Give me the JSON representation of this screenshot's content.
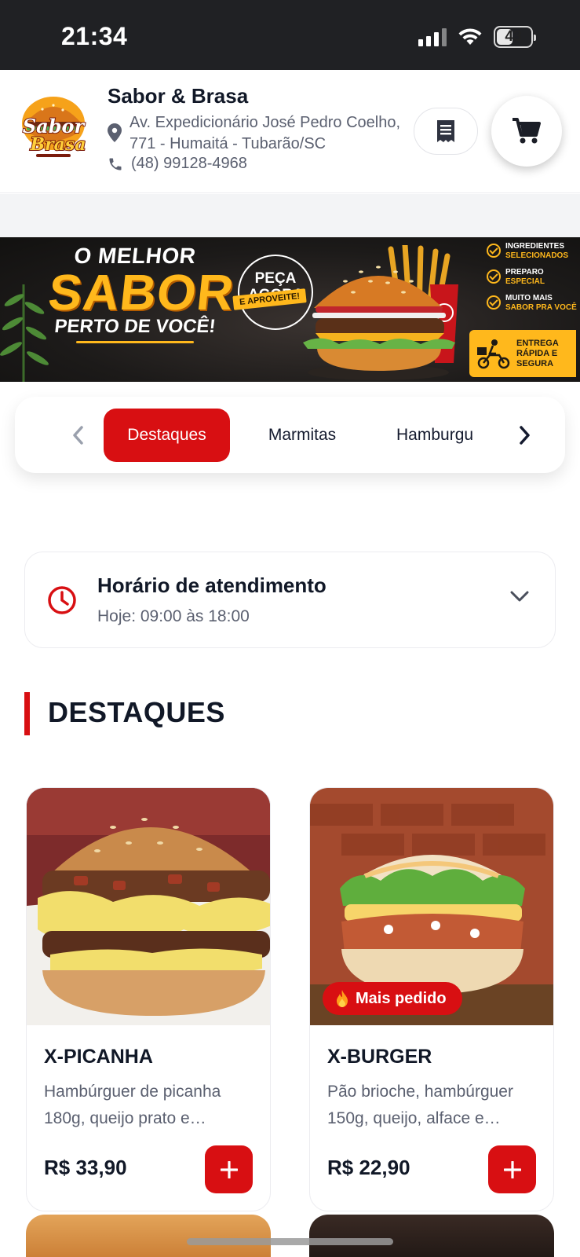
{
  "status_bar": {
    "time": "21:34",
    "battery": "43"
  },
  "header": {
    "shop_name": "Sabor & Brasa",
    "address": "Av. Expedicionário José Pedro Coelho, 771 - Humaitá - Tubarão/SC",
    "phone": "(48) 99128-4968"
  },
  "banner": {
    "line1": "O MELHOR",
    "line2": "SABOR",
    "line3": "PERTO DE VOCÊ!",
    "cta": "PEÇA AGORA",
    "cta_sub": "E APROVEITE!",
    "features": [
      {
        "a": "INGREDIENTES",
        "b": "SELECIONADOS"
      },
      {
        "a": "PREPARO",
        "b": "ESPECIAL"
      },
      {
        "a": "MUITO MAIS",
        "b": "SABOR PRA VOCÊ"
      }
    ],
    "delivery": "ENTREGA RÁPIDA E SEGURA"
  },
  "categories": {
    "items": [
      "Destaques",
      "Marmitas",
      "Hamburgu"
    ],
    "active": "Destaques"
  },
  "hours": {
    "title": "Horário de atendimento",
    "today": "Hoje: 09:00 às 18:00"
  },
  "section": {
    "title": "DESTAQUES"
  },
  "products": [
    {
      "name": "X-PICANHA",
      "description": "Hambúrguer de picanha 180g, queijo prato e…",
      "price": "R$ 33,90",
      "badge": ""
    },
    {
      "name": "X-BURGER",
      "description": "Pão brioche, hambúrguer 150g, queijo, alface e…",
      "price": "R$ 22,90",
      "badge": "Mais pedido"
    }
  ],
  "colors": {
    "accent": "#d80f12",
    "banner_yellow": "#ffb81c",
    "status_bar": "#202124"
  }
}
